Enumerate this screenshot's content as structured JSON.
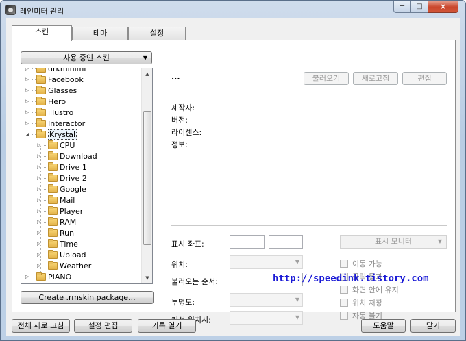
{
  "window": {
    "title": "레인미터 관리"
  },
  "caption_buttons": {
    "minimize": "─",
    "maximize": "□",
    "close": "✕"
  },
  "tabs": [
    {
      "label": "스킨",
      "active": true
    },
    {
      "label": "테마",
      "active": false
    },
    {
      "label": "설정",
      "active": false
    }
  ],
  "skins_panel": {
    "dropdown_label": "사용 중인 스킨",
    "dropdown_arrow": "▼",
    "tree": [
      {
        "label": "drkminiml",
        "level": 0,
        "expander": "▷"
      },
      {
        "label": "Facebook",
        "level": 0,
        "expander": "▷"
      },
      {
        "label": "Glasses",
        "level": 0,
        "expander": "▷"
      },
      {
        "label": "Hero",
        "level": 0,
        "expander": "▷"
      },
      {
        "label": "illustro",
        "level": 0,
        "expander": "▷"
      },
      {
        "label": "Interactor",
        "level": 0,
        "expander": "▷"
      },
      {
        "label": "Krystal",
        "level": 0,
        "expander": "◢",
        "selected": true
      },
      {
        "label": "CPU",
        "level": 1,
        "expander": "▷"
      },
      {
        "label": "Download",
        "level": 1,
        "expander": "▷"
      },
      {
        "label": "Drive 1",
        "level": 1,
        "expander": "▷"
      },
      {
        "label": "Drive 2",
        "level": 1,
        "expander": "▷"
      },
      {
        "label": "Google",
        "level": 1,
        "expander": "▷"
      },
      {
        "label": "Mail",
        "level": 1,
        "expander": "▷"
      },
      {
        "label": "Player",
        "level": 1,
        "expander": "▷"
      },
      {
        "label": "RAM",
        "level": 1,
        "expander": "▷"
      },
      {
        "label": "Run",
        "level": 1,
        "expander": "▷"
      },
      {
        "label": "Time",
        "level": 1,
        "expander": "▷"
      },
      {
        "label": "Upload",
        "level": 1,
        "expander": "▷"
      },
      {
        "label": "Weather",
        "level": 1,
        "expander": "▷"
      },
      {
        "label": "PIANO",
        "level": 0,
        "expander": "▷"
      }
    ],
    "scroll_up": "▲",
    "scroll_down": "▼",
    "create_package_label": "Create .rmskin package..."
  },
  "details": {
    "skin_name": "...",
    "load_button": "불러오기",
    "refresh_button": "새로고침",
    "edit_button": "편집",
    "author_label": "제작자:",
    "version_label": "버전:",
    "license_label": "라이센스:",
    "info_label": "정보:",
    "coords_label": "표시 좌표:",
    "monitor_label": "표시 모니터",
    "position_label": "위치:",
    "load_order_label": "불러오는 순서:",
    "transparency_label": "투명도:",
    "on_hover_label": "커서 위치시:",
    "combo_arrow": "▼",
    "checkboxes": [
      "이동 가능",
      "클릭 통과",
      "화면 안에 유지",
      "위치 저장",
      "자동 불기"
    ]
  },
  "watermark": "http://speedink.tistory.com",
  "bottom_bar": {
    "refresh_all": "전체 새로 고침",
    "edit_settings": "설정 편집",
    "open_log": "기록 열기",
    "help": "도움말",
    "close": "닫기"
  }
}
